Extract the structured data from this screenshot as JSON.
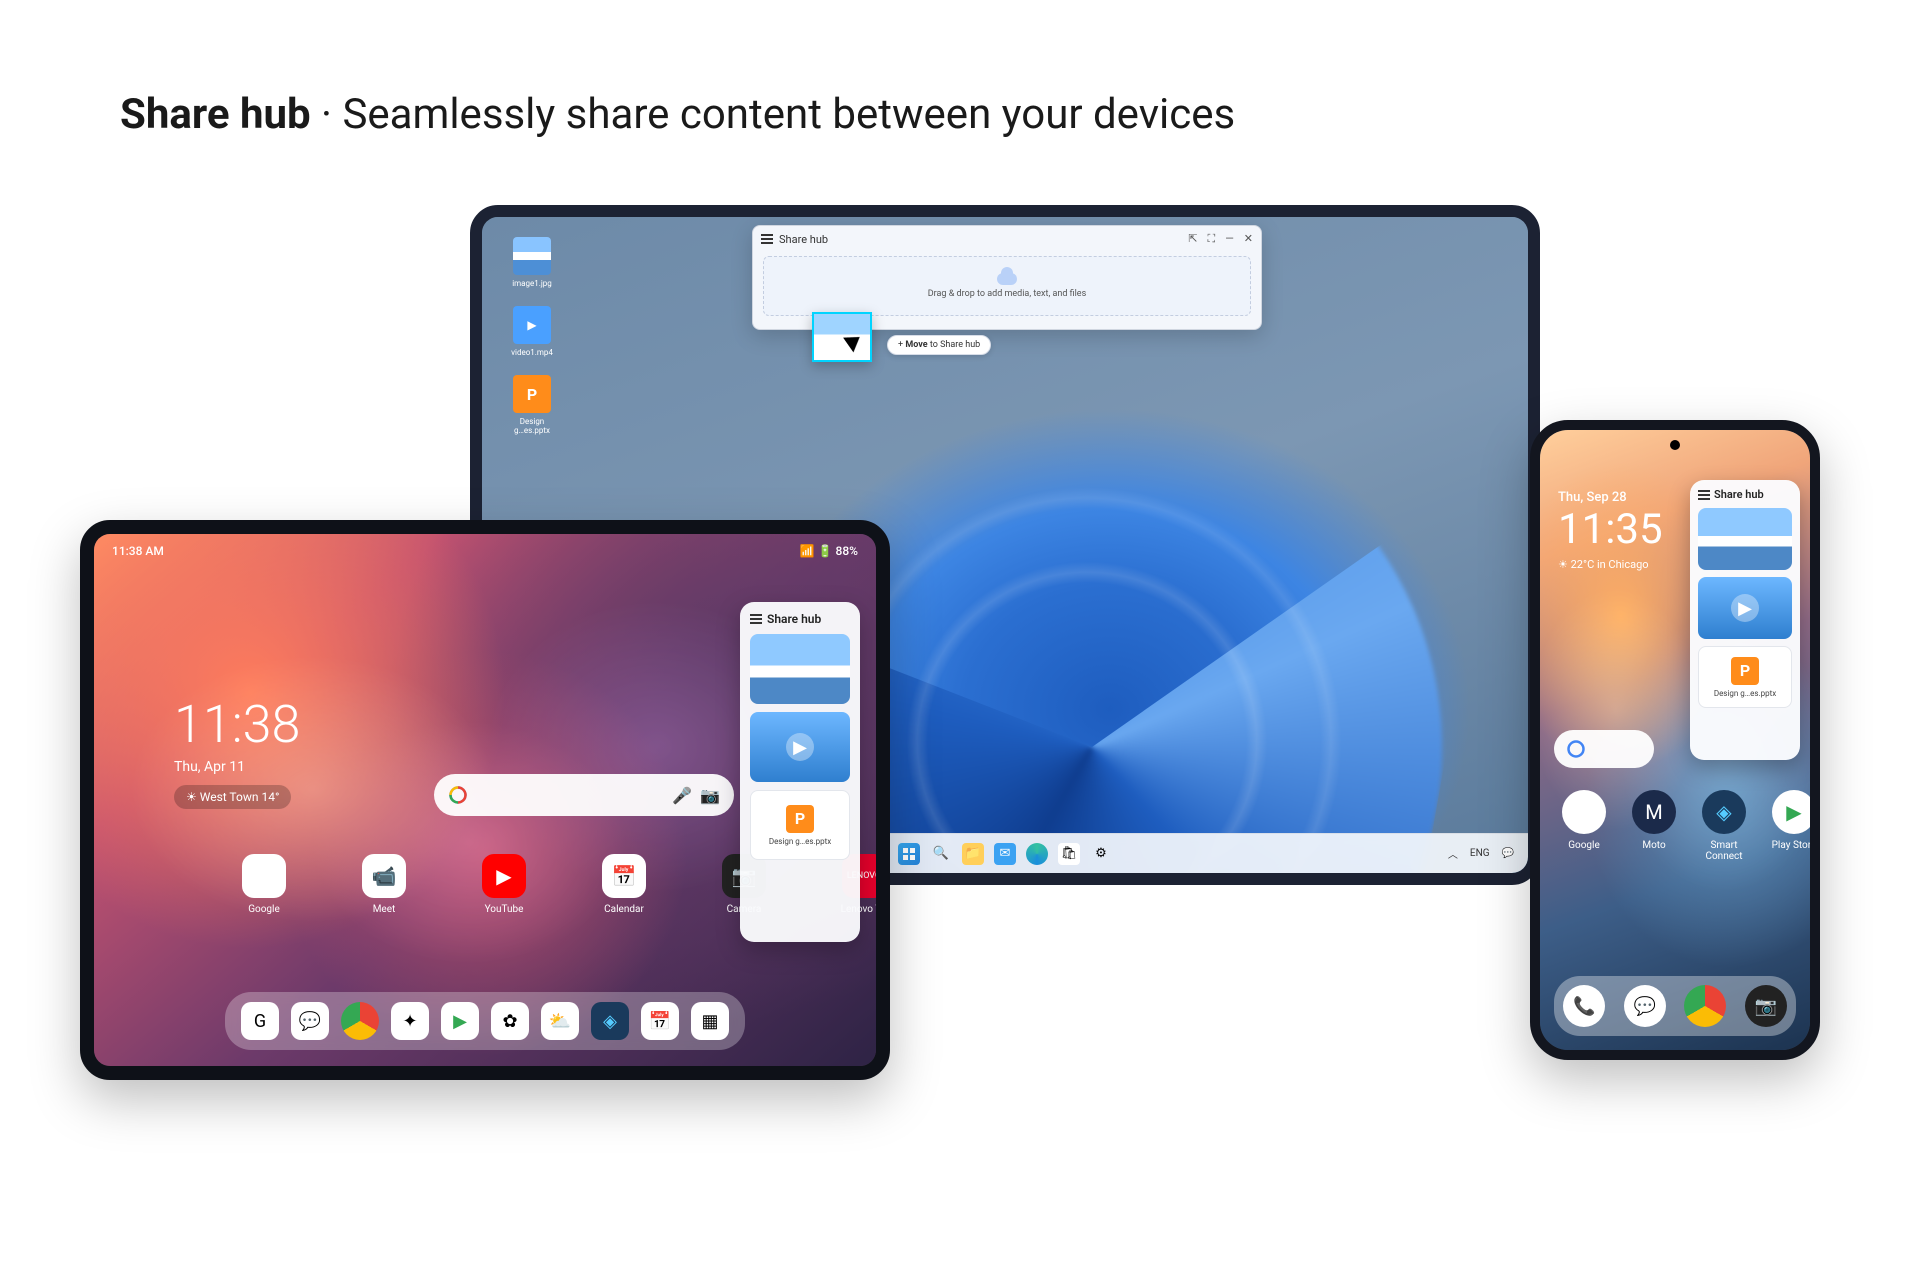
{
  "headline": {
    "bold": "Share hub",
    "sep": " · ",
    "rest": "Seamlessly share content between your devices"
  },
  "laptop": {
    "icons": {
      "img": "image1.jpg",
      "vid": "video1.mp4",
      "ppt_l1": "Design",
      "ppt_l2": "g…es.pptx"
    },
    "sharehub": {
      "title": "Share hub",
      "hint": "Drag & drop to add media, text, and files"
    },
    "tooltip": {
      "plus": "+",
      "move": "Move",
      "to": " to Share hub"
    },
    "taskbar": {
      "lang": "ENG"
    }
  },
  "tablet": {
    "status": {
      "time": "11:38 AM",
      "right": "📶 🔋 88%"
    },
    "clock": {
      "time": "11:38",
      "date": "Thu, Apr 11",
      "weather": "☀  West Town 14°"
    },
    "apps": {
      "a1": "Google",
      "a2": "Meet",
      "a3": "YouTube",
      "a4": "Calendar",
      "a5": "Camera",
      "a6": "Lenovo V…"
    },
    "share": {
      "title": "Share hub",
      "file": "Design g…es.pptx"
    }
  },
  "phone": {
    "clock": {
      "dow": "Thu, Sep 28",
      "time": "11:35",
      "weather": "☀ 22°C in Chicago"
    },
    "apps": {
      "a1": "Google",
      "a2": "Moto",
      "a3": "Smart Connect",
      "a4": "Play Store"
    },
    "share": {
      "title": "Share hub",
      "file": "Design g…es.pptx"
    }
  }
}
